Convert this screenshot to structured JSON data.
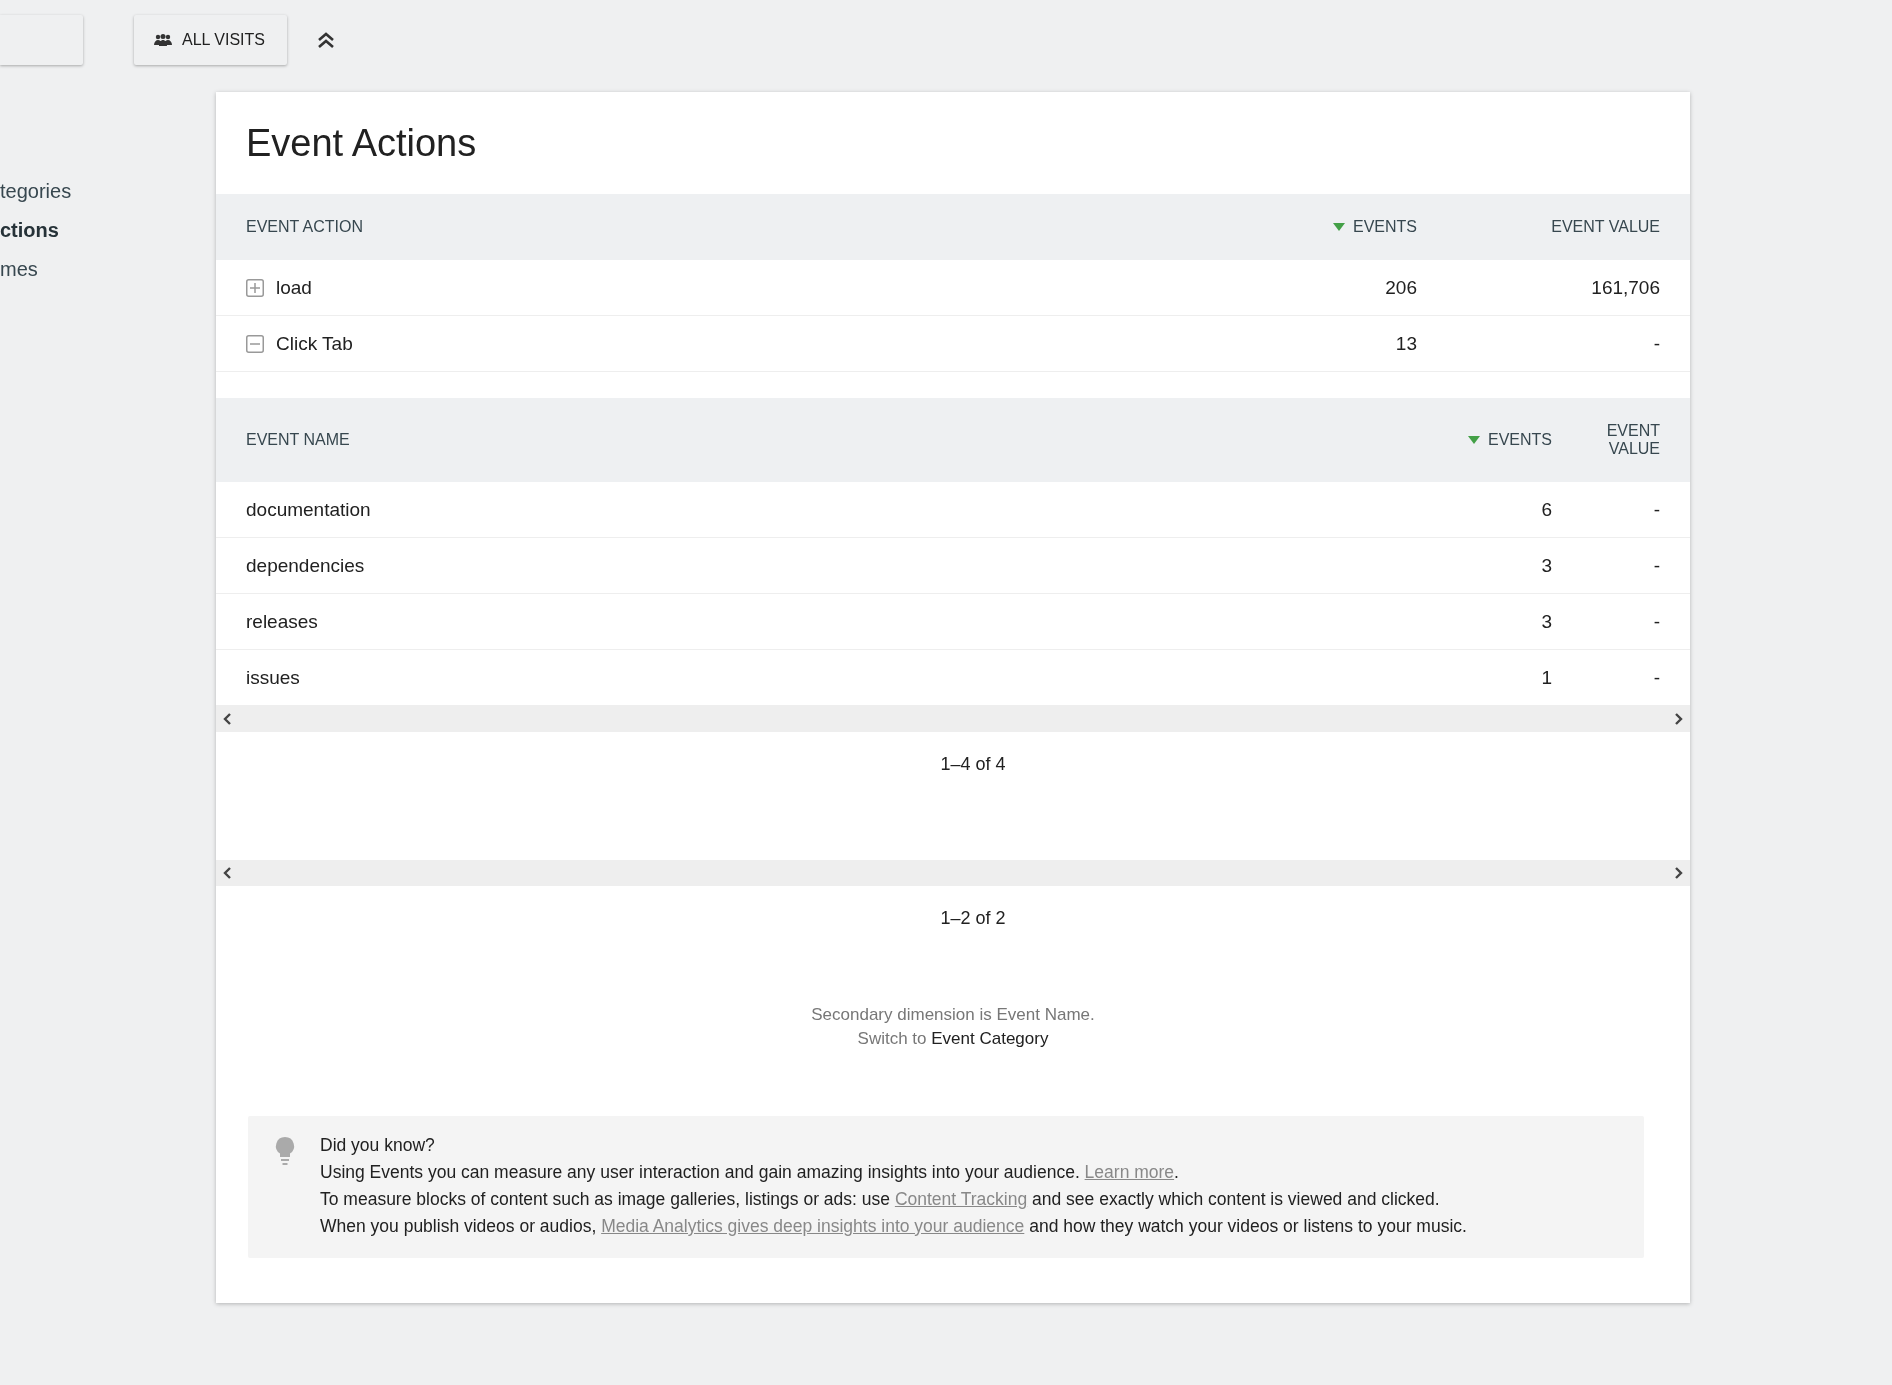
{
  "toolbar": {
    "segment_button": "ALL VISITS"
  },
  "sidebar": {
    "items": [
      {
        "label": "tegories",
        "selected": false
      },
      {
        "label": "ctions",
        "selected": true
      },
      {
        "label": "mes",
        "selected": false
      }
    ]
  },
  "report": {
    "title": "Event Actions",
    "columns": [
      {
        "label": "EVENT ACTION",
        "sorted": false
      },
      {
        "label": "EVENTS",
        "sorted": true
      },
      {
        "label": "EVENT VALUE",
        "sorted": false
      }
    ],
    "rows": [
      {
        "label": "load",
        "events": "206",
        "value": "161,706",
        "expanded": false
      },
      {
        "label": "Click Tab",
        "events": "13",
        "value": "-",
        "expanded": true,
        "subtable": {
          "columns": [
            {
              "label": "EVENT NAME",
              "sorted": false
            },
            {
              "label": "EVENTS",
              "sorted": true
            },
            {
              "label": "EVENT VALUE",
              "sorted": false
            }
          ],
          "rows": [
            {
              "label": "documentation",
              "events": "6",
              "value": "-"
            },
            {
              "label": "dependencies",
              "events": "3",
              "value": "-"
            },
            {
              "label": "releases",
              "events": "3",
              "value": "-"
            },
            {
              "label": "issues",
              "events": "1",
              "value": "-"
            }
          ],
          "pagination": "1–4 of 4"
        }
      }
    ],
    "pagination": "1–2 of 2",
    "secondary": {
      "text": "Secondary dimension is Event Name.",
      "switch_prefix": "Switch to",
      "switch_link": "Event Category"
    },
    "tip": {
      "heading": "Did you know?",
      "lines": [
        {
          "before": "Using Events you can measure any user interaction and gain amazing insights into your audience. ",
          "link": "Learn more",
          "after": "."
        },
        {
          "before": "To measure blocks of content such as image galleries, listings or ads: use ",
          "link": "Content Tracking",
          "after": " and see exactly which content is viewed and clicked."
        },
        {
          "before": "When you publish videos or audios, ",
          "link": "Media Analytics gives deep insights into your audience",
          "after": " and how they watch your videos or listens to your music."
        }
      ]
    }
  }
}
